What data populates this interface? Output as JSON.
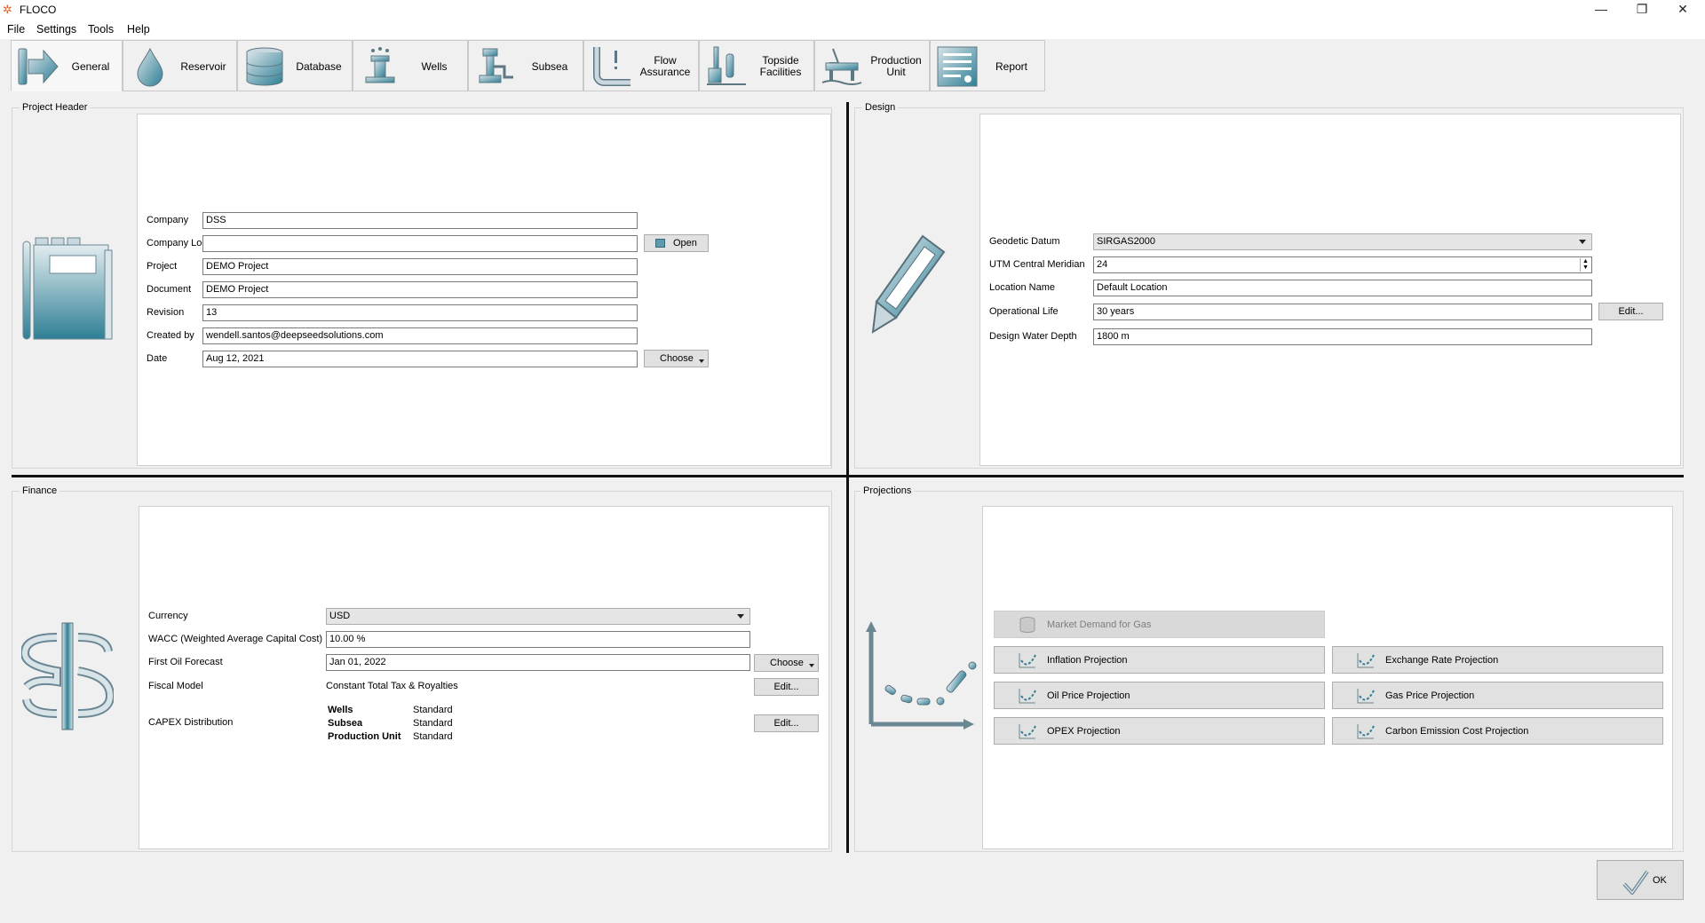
{
  "window": {
    "title": "FLOCO"
  },
  "menu": [
    "File",
    "Settings",
    "Tools",
    "Help"
  ],
  "tabs": [
    {
      "label": "General",
      "icon": "arrow-right-icon"
    },
    {
      "label": "Reservoir",
      "icon": "droplet-icon"
    },
    {
      "label": "Database",
      "icon": "database-icon"
    },
    {
      "label": "Wells",
      "icon": "wellhead-icon"
    },
    {
      "label": "Subsea",
      "icon": "subsea-tree-icon"
    },
    {
      "label": "Flow\nAssurance",
      "icon": "pipe-bend-icon"
    },
    {
      "label": "Topside\nFacilities",
      "icon": "topside-facility-icon"
    },
    {
      "label": "Production\nUnit",
      "icon": "platform-icon"
    },
    {
      "label": "Report",
      "icon": "report-icon"
    }
  ],
  "project_header": {
    "title": "Project Header",
    "company_label": "Company",
    "company": "DSS",
    "logo_label": "Company Logo",
    "logo": "",
    "open_button": "Open",
    "project_label": "Project",
    "project": "DEMO Project",
    "document_label": "Document",
    "document": "DEMO Project",
    "revision_label": "Revision",
    "revision": "13",
    "created_by_label": "Created by",
    "created_by": "wendell.santos@deepseedsolutions.com",
    "date_label": "Date",
    "date": "Aug 12, 2021",
    "choose_button": "Choose"
  },
  "design": {
    "title": "Design",
    "datum_label": "Geodetic Datum",
    "datum": "SIRGAS2000",
    "utm_label": "UTM Central Meridian",
    "utm": "24",
    "location_label": "Location Name",
    "location": "Default Location",
    "life_label": "Operational Life",
    "life": "30 years",
    "edit_button": "Edit...",
    "depth_label": "Design Water Depth",
    "depth": "1800 m"
  },
  "finance": {
    "title": "Finance",
    "currency_label": "Currency",
    "currency": "USD",
    "wacc_label": "WACC (Weighted Average Capital Cost)",
    "wacc": "10.00 %",
    "first_oil_label": "First Oil Forecast",
    "first_oil": "Jan 01, 2022",
    "choose_button": "Choose",
    "fiscal_label": "Fiscal Model",
    "fiscal": "Constant Total Tax & Royalties",
    "fiscal_edit": "Edit...",
    "capex_label": "CAPEX Distribution",
    "capex_edit": "Edit...",
    "capex": [
      {
        "name": "Wells",
        "value": "Standard"
      },
      {
        "name": "Subsea",
        "value": "Standard"
      },
      {
        "name": "Production Unit",
        "value": "Standard"
      }
    ]
  },
  "projections": {
    "title": "Projections",
    "market_demand": "Market Demand for Gas",
    "inflation": "Inflation Projection",
    "exchange": "Exchange Rate Projection",
    "oil_price": "Oil Price Projection",
    "gas_price": "Gas Price Projection",
    "opex": "OPEX Projection",
    "carbon": "Carbon Emission Cost Projection"
  },
  "ok_button": "OK",
  "colors": {
    "accent_teal": "#2f7f95",
    "panel_bg": "#f0f0f0",
    "divider": "#111111"
  }
}
